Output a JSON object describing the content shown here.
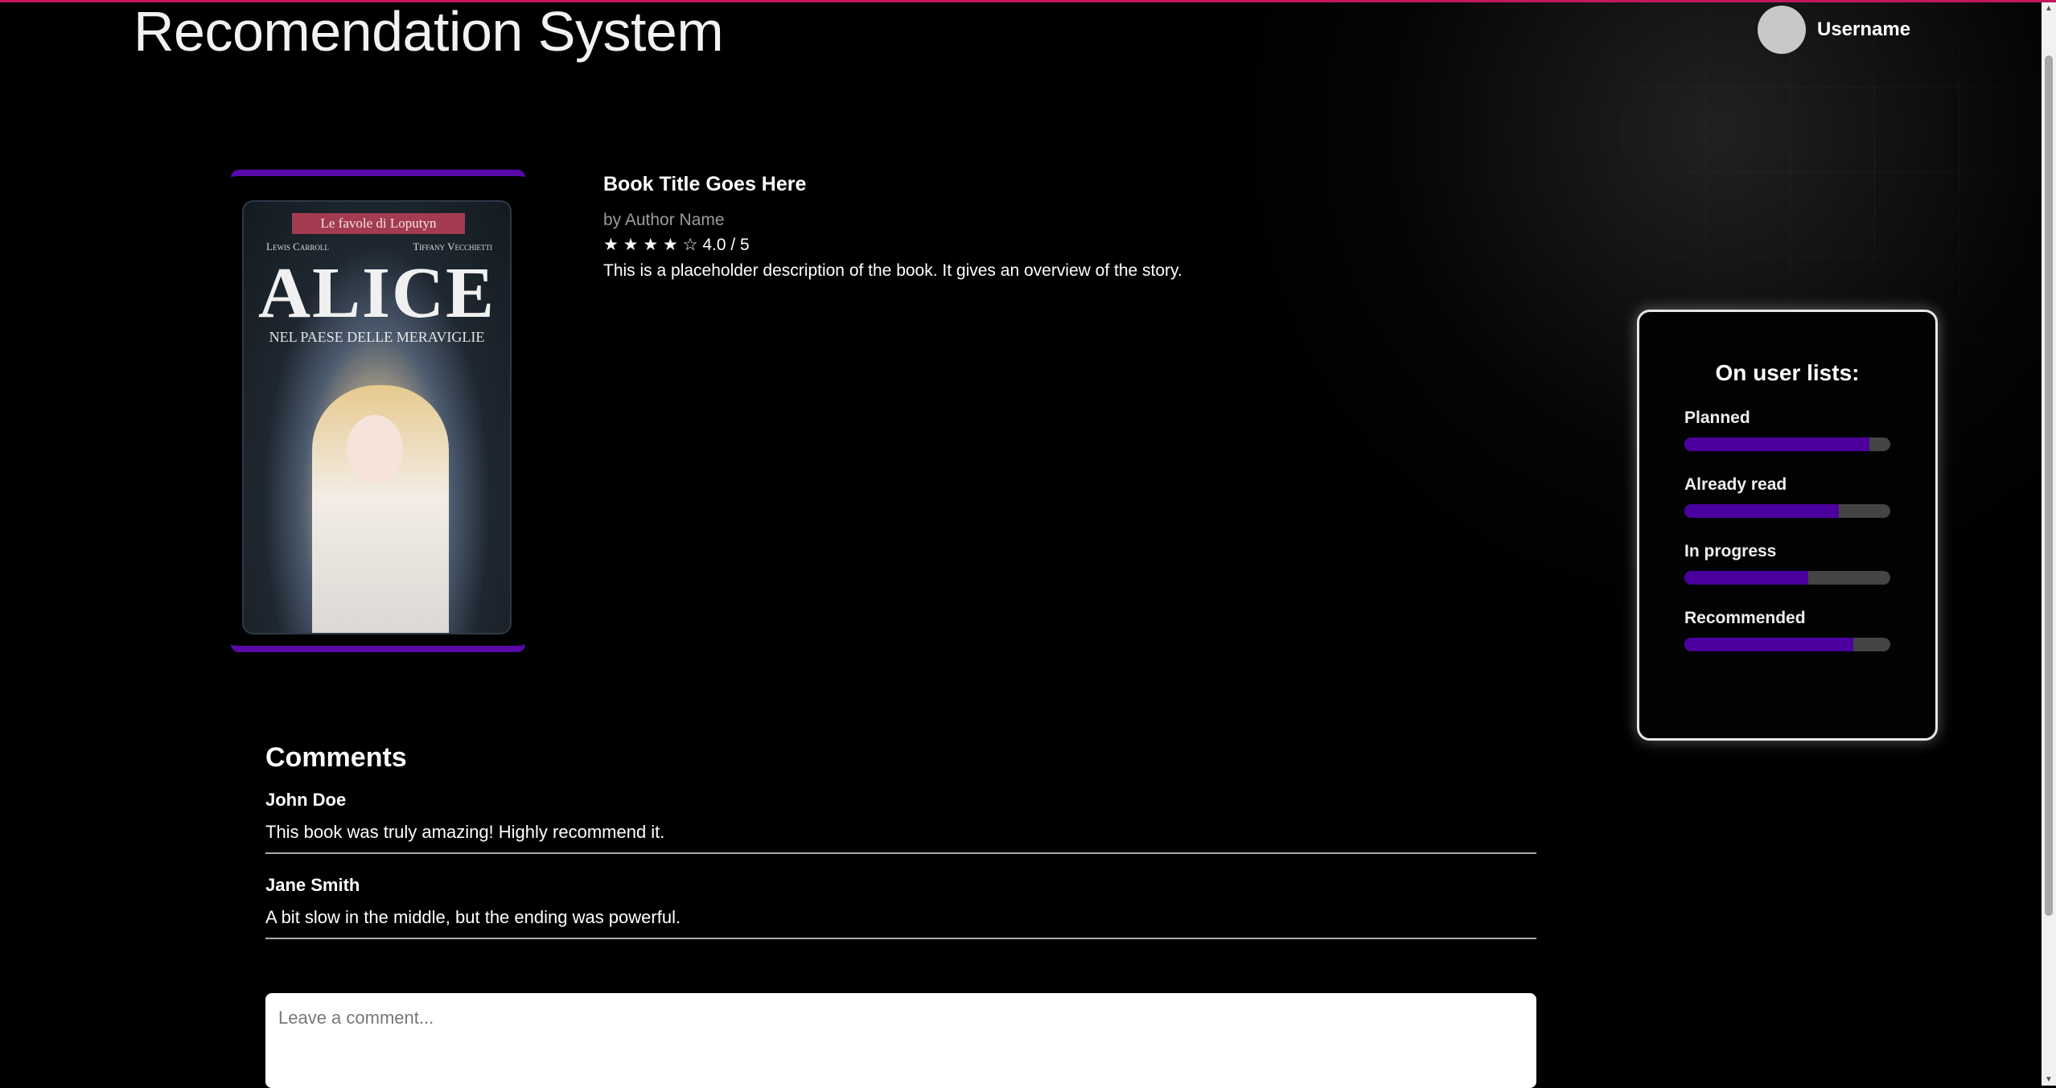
{
  "header": {
    "title": "Recomendation System",
    "username": "Username"
  },
  "book": {
    "title": "Book Title Goes Here",
    "author": "by Author Name",
    "rating_stars": "★ ★ ★ ★ ☆",
    "rating_value": 4.0,
    "rating_text": "4.0 / 5",
    "description": "This is a placeholder description of the book. It gives an overview of the story.",
    "cover": {
      "series": "Le favole di Loputyn",
      "author1": "Lewis Carroll",
      "author2": "Tiffany Vecchietti",
      "title": "ALICE",
      "subtitle": "nel paese delle meraviglie"
    }
  },
  "stats": {
    "heading": "On user lists:",
    "accent": "#4b009e",
    "items": [
      {
        "label": "Planned",
        "fraction": 0.9
      },
      {
        "label": "Already read",
        "fraction": 0.75
      },
      {
        "label": "In progress",
        "fraction": 0.6
      },
      {
        "label": "Recommended",
        "fraction": 0.82
      }
    ]
  },
  "comments": {
    "heading": "Comments",
    "items": [
      {
        "author": "John Doe",
        "text": "This book was truly amazing! Highly recommend it."
      },
      {
        "author": "Jane Smith",
        "text": "A bit slow in the middle, but the ending was powerful."
      }
    ],
    "placeholder": "Leave a comment..."
  }
}
